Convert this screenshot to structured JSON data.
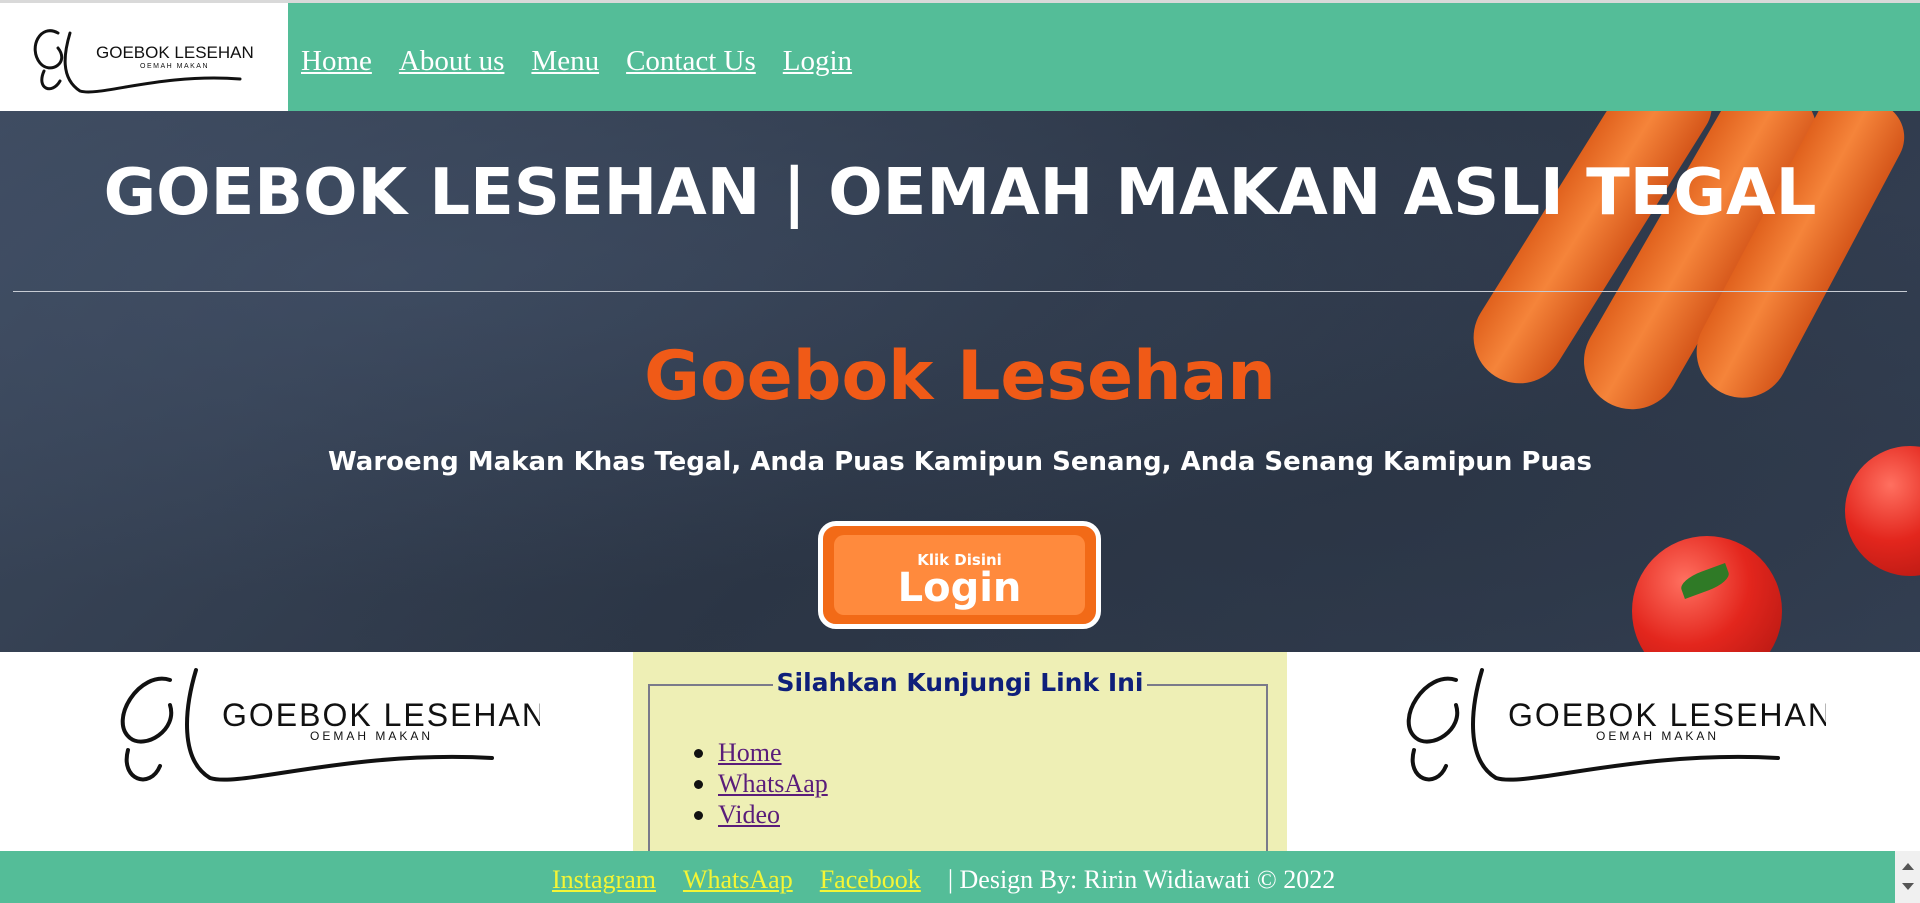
{
  "nav": {
    "logo": {
      "monogram": "Gl",
      "name": "GOEBOK LESEHAN",
      "sub": "OEMAH MAKAN"
    },
    "links": [
      "Home",
      "About us",
      "Menu",
      "Contact Us",
      "Login"
    ]
  },
  "hero": {
    "title": "GOEBOK LESEHAN | OEMAH MAKAN ASLI TEGAL",
    "name": "Goebok Lesehan",
    "tagline": "Waroeng Makan Khas Tegal, Anda Puas Kamipun Senang, Anda Senang Kamipun Puas",
    "button_small": "Klik Disini",
    "button_big": "Login"
  },
  "links_box": {
    "legend": "Silahkan Kunjungi Link Ini",
    "items": [
      "Home",
      "WhatsAap",
      "Video"
    ]
  },
  "footer": {
    "links": [
      "Instagram",
      "WhatsAap",
      "Facebook"
    ],
    "credit": "| Design By: Ririn Widiawati © 2022"
  },
  "colors": {
    "nav_bg": "#54bd98",
    "accent_orange": "#f05a17",
    "footer_link": "#f4f535",
    "box_bg": "#eeefb5"
  }
}
